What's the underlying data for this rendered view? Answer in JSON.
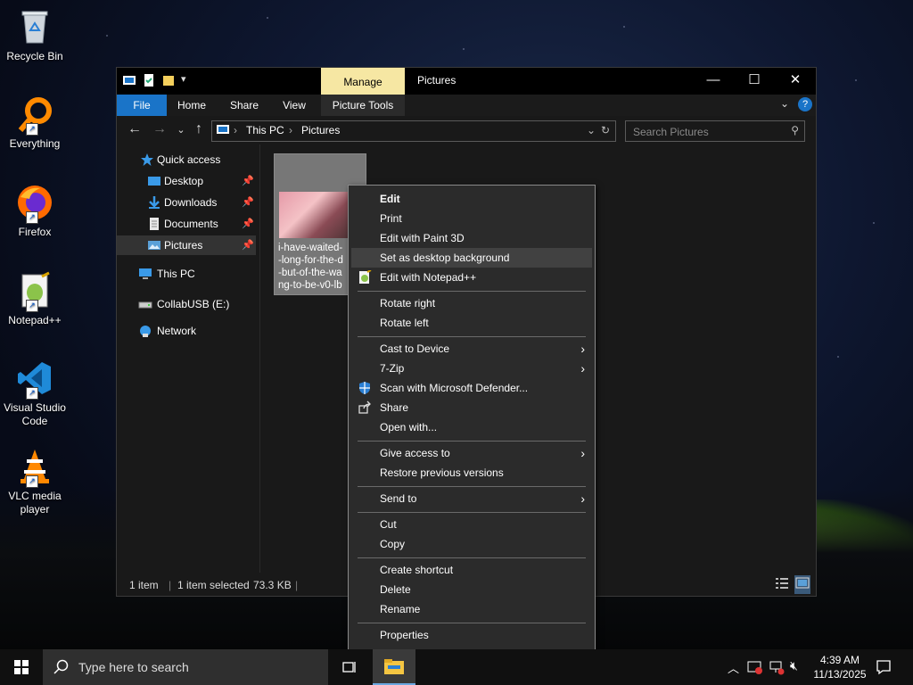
{
  "desktop": {
    "icons": [
      {
        "label": "Recycle Bin"
      },
      {
        "label": "Everything"
      },
      {
        "label": "Firefox"
      },
      {
        "label": "Notepad++"
      },
      {
        "label": "Visual Studio Code"
      },
      {
        "label": "VLC media player"
      }
    ]
  },
  "explorer": {
    "title": "Pictures",
    "manage_tab": "Manage",
    "ribbon_tabs": {
      "file": "File",
      "home": "Home",
      "share": "Share",
      "view": "View",
      "picture_tools": "Picture Tools"
    },
    "breadcrumb": [
      "This PC",
      "Pictures"
    ],
    "search_placeholder": "Search Pictures",
    "nav": {
      "quick_access": "Quick access",
      "desktop": "Desktop",
      "downloads": "Downloads",
      "documents": "Documents",
      "pictures": "Pictures",
      "this_pc": "This PC",
      "usb": "CollabUSB (E:)",
      "network": "Network"
    },
    "file": {
      "name_lines": [
        "i-have-waited-",
        "-long-for-the-d",
        "-but-of-the-wa",
        "ng-to-be-v0-lb"
      ]
    },
    "status": {
      "count": "1 item",
      "selected": "1 item selected",
      "size": "73.3 KB"
    }
  },
  "context_menu": {
    "items": [
      {
        "label": "Edit"
      },
      {
        "label": "Print"
      },
      {
        "label": "Edit with Paint 3D"
      },
      {
        "label": "Set as desktop background"
      },
      {
        "label": "Edit with Notepad++"
      },
      {
        "label": "Rotate right"
      },
      {
        "label": "Rotate left"
      },
      {
        "label": "Cast to Device"
      },
      {
        "label": "7-Zip"
      },
      {
        "label": "Scan with Microsoft Defender..."
      },
      {
        "label": "Share"
      },
      {
        "label": "Open with..."
      },
      {
        "label": "Give access to"
      },
      {
        "label": "Restore previous versions"
      },
      {
        "label": "Send to"
      },
      {
        "label": "Cut"
      },
      {
        "label": "Copy"
      },
      {
        "label": "Create shortcut"
      },
      {
        "label": "Delete"
      },
      {
        "label": "Rename"
      },
      {
        "label": "Properties"
      }
    ]
  },
  "taskbar": {
    "search_placeholder": "Type here to search",
    "time": "4:39 AM",
    "date": "11/13/2025"
  },
  "colors": {
    "accent": "#1a74c8",
    "manage_tab": "#f6e7a3",
    "menu_bg": "#2b2b2b",
    "window_bg": "#191919"
  }
}
